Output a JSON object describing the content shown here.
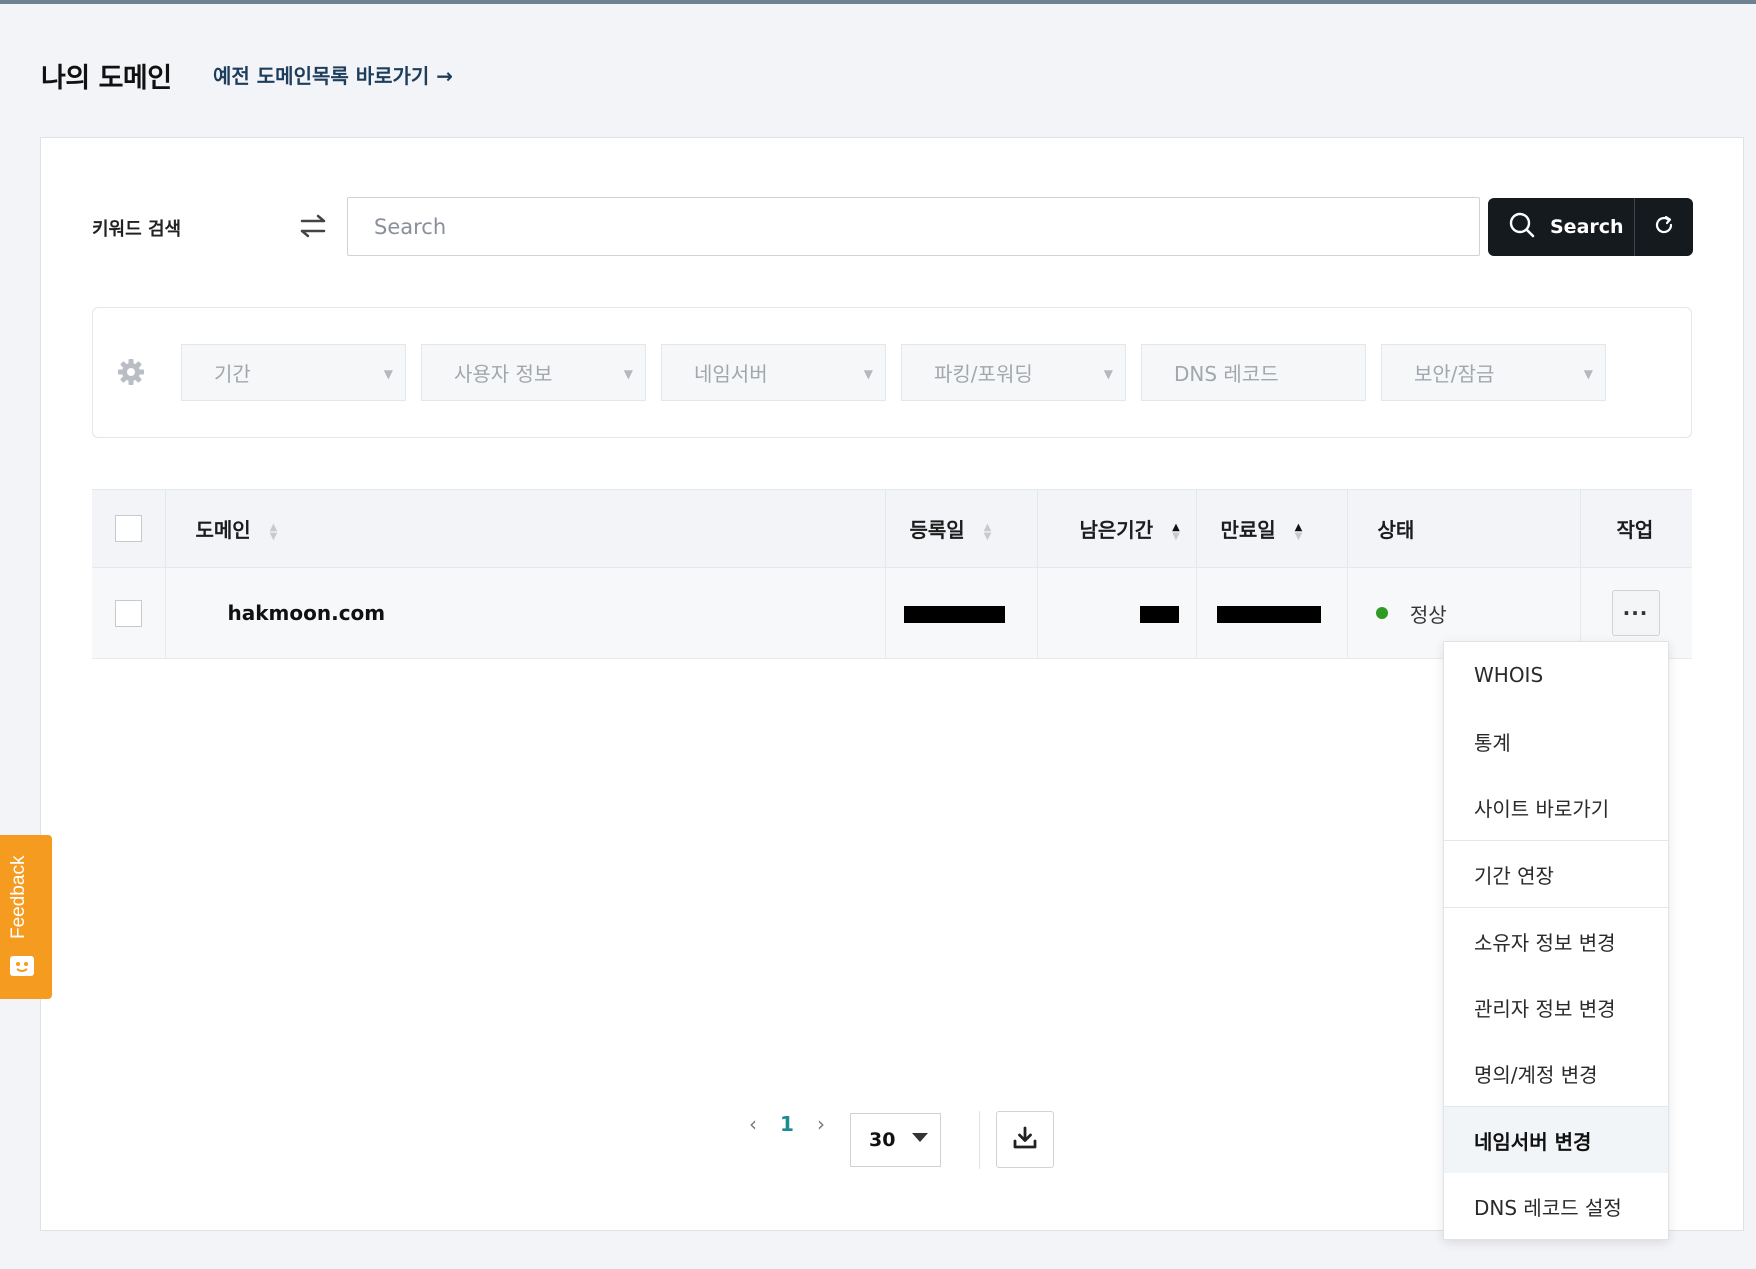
{
  "header": {
    "title": "나의 도메인",
    "old_list_link": "예전 도메인목록 바로가기 →"
  },
  "search": {
    "keyword_label": "키워드 검색",
    "placeholder": "Search",
    "value": "",
    "button_label": "Search"
  },
  "filters": [
    {
      "label": "기간",
      "has_caret": true
    },
    {
      "label": "사용자 정보",
      "has_caret": true
    },
    {
      "label": "네임서버",
      "has_caret": true
    },
    {
      "label": "파킹/포워딩",
      "has_caret": true
    },
    {
      "label": "DNS 레코드",
      "has_caret": false
    },
    {
      "label": "보안/잠금",
      "has_caret": true
    }
  ],
  "table": {
    "columns": {
      "domain": "도메인",
      "registered": "등록일",
      "remaining": "남은기간",
      "expiry": "만료일",
      "status": "상태",
      "action": "작업"
    },
    "rows": [
      {
        "domain": "hakmoon.com",
        "registered": "[redacted]",
        "remaining": "[redacted]",
        "expiry": "[redacted]",
        "status": "정상",
        "status_color": "#2e9b23"
      }
    ]
  },
  "action_menu": {
    "groups": [
      [
        "WHOIS",
        "통계",
        "사이트 바로가기"
      ],
      [
        "기간 연장"
      ],
      [
        "소유자 정보 변경",
        "관리자 정보 변경",
        "명의/계정 변경"
      ],
      [
        "네임서버 변경",
        "DNS 레코드 설정"
      ]
    ],
    "active_item": "네임서버 변경"
  },
  "pagination": {
    "current_page": "1",
    "prev": "‹",
    "next": "›",
    "per_page": "30"
  },
  "feedback": {
    "label": "Feedback",
    "color": "#f59b1f"
  },
  "colors": {
    "accent_teal": "#1a8c93",
    "button_dark": "#151a1e"
  }
}
